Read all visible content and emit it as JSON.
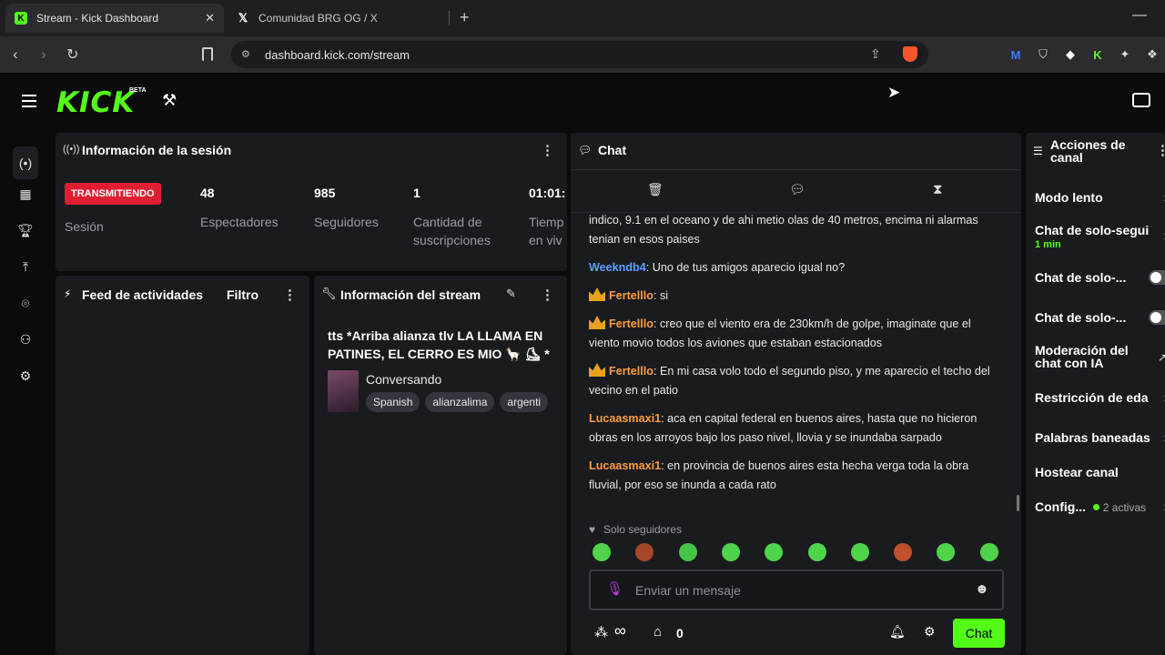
{
  "browser": {
    "tabs": [
      {
        "title": "Stream - Kick Dashboard",
        "active": true
      },
      {
        "title": "Comunidad BRG OG / X",
        "active": false
      }
    ],
    "url": "dashboard.kick.com/stream"
  },
  "header": {
    "logo": "KICK",
    "badge": "BETA"
  },
  "session": {
    "title": "Información de la sesión",
    "live_badge": "TRANSMITIENDO",
    "session_label": "Sesión",
    "stats": [
      {
        "value": "48",
        "label": "Espectadores"
      },
      {
        "value": "985",
        "label": "Seguidores"
      },
      {
        "value": "1",
        "label": "Cantidad de suscripciones"
      },
      {
        "value": "01:01:",
        "label": "Tiemp en viv"
      }
    ]
  },
  "activity": {
    "title": "Feed de actividades",
    "filter": "Filtro"
  },
  "stream_info": {
    "title": "Información del stream",
    "stream_title": "tts *Arriba alianza tlv LA LLAMA EN PATINES, EL CERRO ES MIO 🦙 ⛸ *",
    "category": "Conversando",
    "tags": [
      "Spanish",
      "alianzalima",
      "argenti"
    ]
  },
  "chat": {
    "title": "Chat",
    "messages": [
      {
        "user": "",
        "text": "indico, 9.1 en el oceano y de ahi metio olas de 40 metros, encima ni alarmas tenian en esos paises",
        "color": "none",
        "crown": false
      },
      {
        "user": "Weekndb4",
        "text": ": Uno de tus amigos aparecio igual no?",
        "color": "blue",
        "crown": false
      },
      {
        "user": "Fertelllo",
        "text": ": si",
        "color": "orange",
        "crown": true
      },
      {
        "user": "Fertelllo",
        "text": ": creo que el viento era de 230km/h de golpe, imaginate que el viento movio todos los aviones que estaban estacionados",
        "color": "orange",
        "crown": true
      },
      {
        "user": "Fertelllo",
        "text": ": En mi casa volo todo el segundo piso, y me aparecio el techo del vecino en el patio",
        "color": "orange",
        "crown": true
      },
      {
        "user": "Lucaasmaxi1",
        "text": ": aca en capital federal en buenos aires, hasta que no hicieron obras en los arroyos bajo los paso nivel, llovia y se inundaba sarpado",
        "color": "orange",
        "crown": false
      },
      {
        "user": "Lucaasmaxi1",
        "text": ": en provincia de buenos aires esta hecha verga toda la obra fluvial, por eso se inunda a cada rato",
        "color": "orange",
        "crown": false
      }
    ],
    "followers_only": "Solo seguidores",
    "input_placeholder": "Enviar un mensaje",
    "points": "0",
    "send_label": "Chat"
  },
  "actions": {
    "title": "Acciones de canal",
    "items": [
      {
        "label": "Modo lento"
      },
      {
        "label": "Chat de solo-segui",
        "sub": "1 min"
      },
      {
        "label": "Chat de solo-..."
      },
      {
        "label": "Chat de solo-..."
      },
      {
        "label": "Moderación del chat con IA"
      },
      {
        "label": "Restricción de eda"
      },
      {
        "label": "Palabras baneadas"
      },
      {
        "label": "Hostear canal"
      },
      {
        "label": "Config...",
        "sub": "2 activas"
      }
    ]
  },
  "colors": {
    "brand": "#53fc18",
    "live": "#e01e32",
    "panel": "#191b1f"
  }
}
